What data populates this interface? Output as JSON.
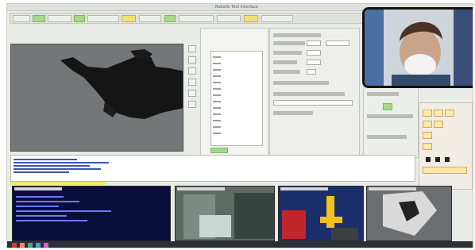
{
  "window": {
    "title": "Robotic Tool Interface"
  },
  "colors": {
    "accent_green": "#a8d98a",
    "terminal_bg": "#0b0e3a",
    "taskbar_bg": "#2b2f36"
  },
  "icons": [
    "window-close-icon",
    "play-icon",
    "stop-icon",
    "camera-icon"
  ]
}
